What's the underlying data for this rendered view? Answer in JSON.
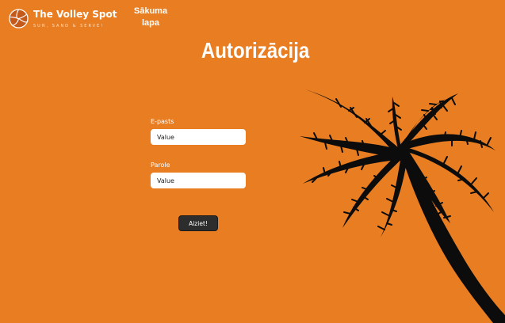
{
  "brand": {
    "name": "The Volley Spot",
    "tagline": "SUN, SAND & SERVE!"
  },
  "nav": {
    "home_label": "Sākuma lapa"
  },
  "page": {
    "title": "Autorizācija"
  },
  "form": {
    "email": {
      "label": "E-pasts",
      "value": "Value"
    },
    "password": {
      "label": "Parole",
      "value": "Value"
    },
    "submit_label": "Aiziet!"
  },
  "colors": {
    "background": "#e97d22",
    "button": "#2d2d2d",
    "logo_ball": "#c4591a"
  },
  "icons": {
    "logo": "volleyball-icon",
    "decoration": "palm-tree-icon"
  }
}
